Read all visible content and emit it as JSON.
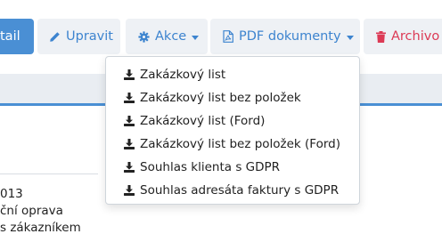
{
  "toolbar": {
    "detail_label": "tail",
    "edit_label": "Upravit",
    "actions_label": "Akce",
    "pdf_label": "PDF dokumenty",
    "archive_label": "Archivo"
  },
  "pdf_menu": {
    "items": [
      {
        "label": "Zakázkový list",
        "icon": "download-icon"
      },
      {
        "label": "Zakázkový list bez položek",
        "icon": "download-icon"
      },
      {
        "label": "Zakázkový list (Ford)",
        "icon": "download-icon"
      },
      {
        "label": "Zakázkový list bez položek (Ford)",
        "icon": "download-icon"
      },
      {
        "label": "Souhlas klienta s GDPR",
        "icon": "download-icon"
      },
      {
        "label": "Souhlas adresáta faktury s GDPR",
        "icon": "download-icon"
      }
    ]
  },
  "background": {
    "line1": "013",
    "line2": "ční oprava",
    "line3": "s zákazníkem"
  },
  "colors": {
    "primary": "#4a8fd4",
    "link": "#3d84cf",
    "danger": "#dc3a55",
    "light_button": "#eef1f5"
  }
}
